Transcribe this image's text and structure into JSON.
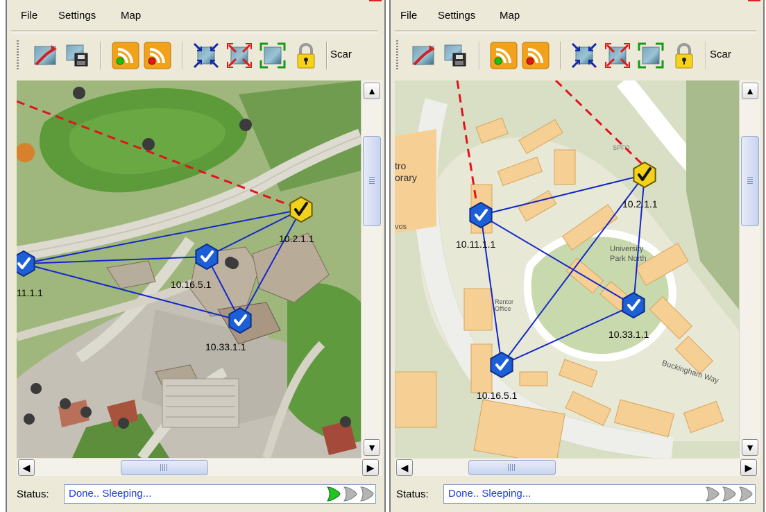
{
  "menu": [
    "File",
    "Settings",
    "Map"
  ],
  "toolbar": {
    "buttons": [
      "map-arrow-icon",
      "save-map-icon",
      "wifi-green-icon",
      "wifi-red-icon",
      "shrink-map-icon",
      "expand-map-icon",
      "fit-map-icon",
      "lock-icon"
    ],
    "scan_label": "Scar"
  },
  "status": {
    "label": "Status:",
    "text": "Done.. Sleeping..."
  },
  "colors": {
    "link": "#1428c8",
    "wan_link": "#e0141e",
    "node_ok": "#1d5fd6",
    "node_gateway": "#f2d21a",
    "status_text": "#1a3bd8"
  },
  "panes": [
    {
      "map_style": "illustrated campus map",
      "status_indicator_active": true,
      "nodes": [
        {
          "id": "10.2.1.1",
          "label": "10.2.1.1",
          "kind": "gateway"
        },
        {
          "id": "10.11.1.1",
          "label": "11.1.1",
          "kind": "ok"
        },
        {
          "id": "10.16.5.1",
          "label": "10.16.5.1",
          "kind": "ok"
        },
        {
          "id": "10.33.1.1",
          "label": "10.33.1.1",
          "kind": "ok"
        }
      ],
      "links": [
        [
          "10.2.1.1",
          "10.11.1.1"
        ],
        [
          "10.2.1.1",
          "10.16.5.1"
        ],
        [
          "10.2.1.1",
          "10.33.1.1"
        ],
        [
          "10.11.1.1",
          "10.16.5.1"
        ],
        [
          "10.11.1.1",
          "10.33.1.1"
        ],
        [
          "10.16.5.1",
          "10.33.1.1"
        ]
      ]
    },
    {
      "map_style": "street map",
      "status_indicator_active": false,
      "map_labels": [
        "tro",
        "orary",
        "vos",
        "University",
        "Park North",
        "Rentor",
        "Office",
        "Buckingham Way",
        "SPFO"
      ],
      "nodes": [
        {
          "id": "10.2.1.1",
          "label": "10.2.1.1",
          "kind": "gateway"
        },
        {
          "id": "10.11.1.1",
          "label": "10.11.1.1",
          "kind": "ok"
        },
        {
          "id": "10.16.5.1",
          "label": "10.16.5.1",
          "kind": "ok"
        },
        {
          "id": "10.33.1.1",
          "label": "10.33.1.1",
          "kind": "ok"
        }
      ],
      "links": [
        [
          "10.2.1.1",
          "10.11.1.1"
        ],
        [
          "10.2.1.1",
          "10.16.5.1"
        ],
        [
          "10.2.1.1",
          "10.33.1.1"
        ],
        [
          "10.11.1.1",
          "10.16.5.1"
        ],
        [
          "10.11.1.1",
          "10.33.1.1"
        ],
        [
          "10.16.5.1",
          "10.33.1.1"
        ]
      ]
    }
  ]
}
